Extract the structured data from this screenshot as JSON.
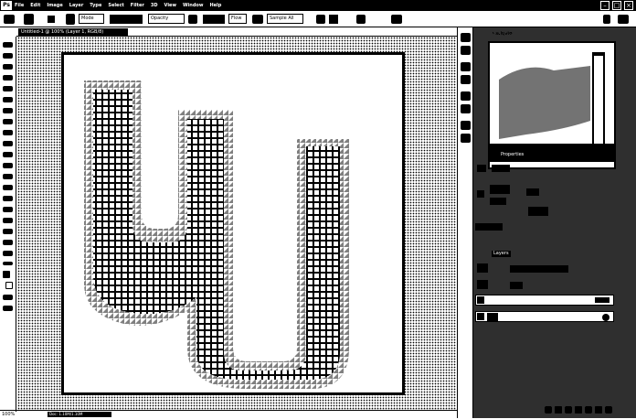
{
  "menubar": {
    "app_logo": "Ps",
    "items": [
      "File",
      "Edit",
      "Image",
      "Layer",
      "Type",
      "Select",
      "Filter",
      "3D",
      "View",
      "Window",
      "Help"
    ],
    "window_buttons": [
      "–",
      "□",
      "×"
    ]
  },
  "options": {
    "sample_label": "Sample All",
    "mode_label": "Mode",
    "opacity_label": "Opacity",
    "flow_label": "Flow"
  },
  "document": {
    "tab_label": "Untitled-1 @ 100% (Layer 1, RGB/8)"
  },
  "status": {
    "zoom": "100%",
    "info": "Doc: 1.10M/1.10M"
  },
  "panels": {
    "navigator_tab": "Navigator",
    "properties_tab": "Properties",
    "layers_tab": "Layers"
  }
}
